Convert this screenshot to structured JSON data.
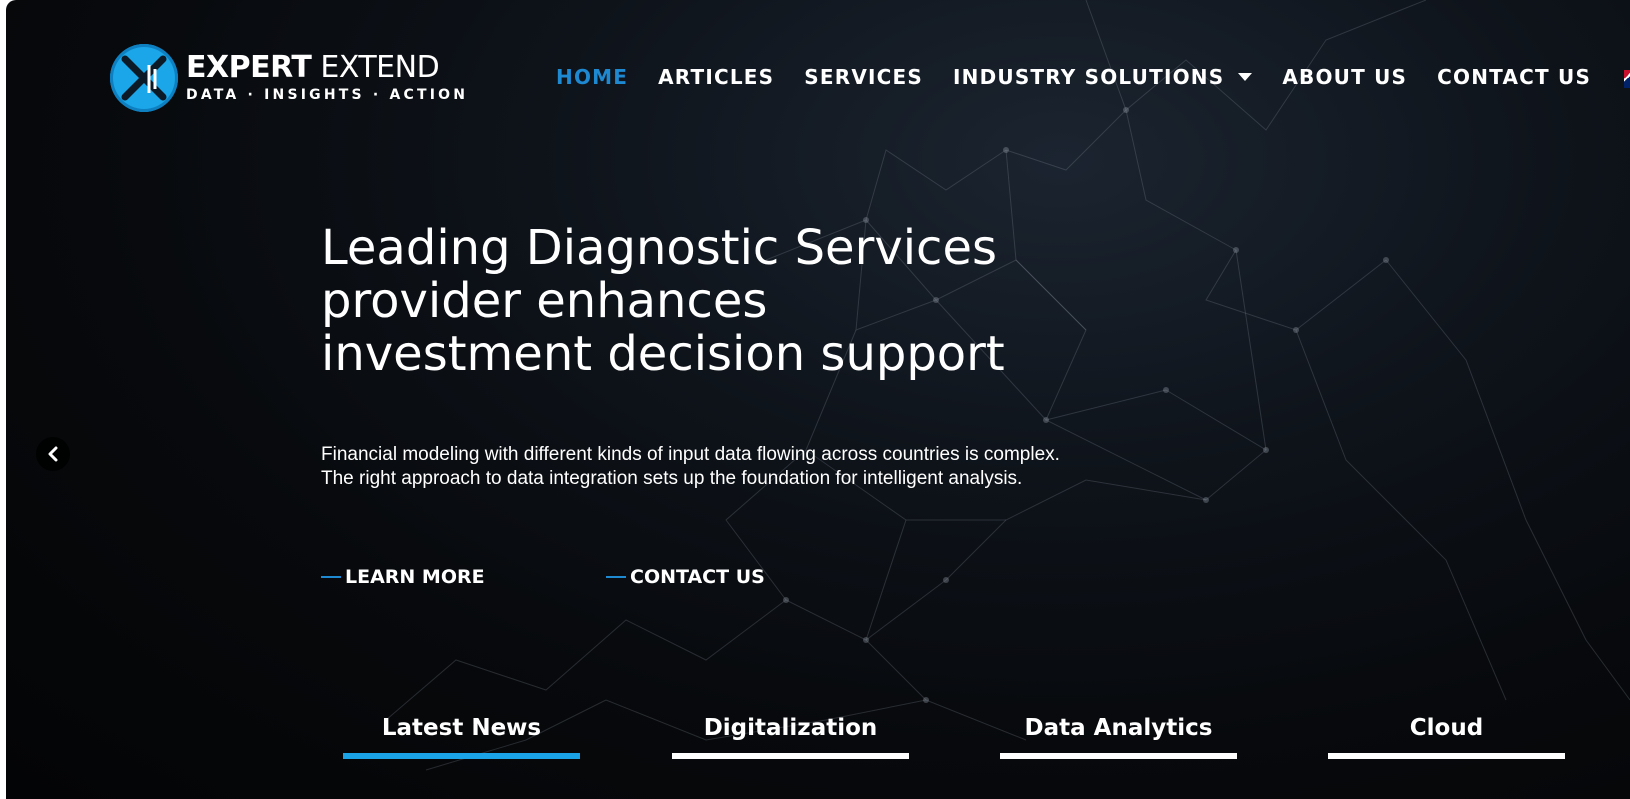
{
  "brand": {
    "name_bold": "EXPERT",
    "name_light": "EXTEND",
    "tagline": "DATA · INSIGHTS · ACTION",
    "accent_color": "#1aa6e8"
  },
  "nav": {
    "items": [
      {
        "label": "HOME",
        "active": true
      },
      {
        "label": "ARTICLES"
      },
      {
        "label": "SERVICES"
      },
      {
        "label": "INDUSTRY SOLUTIONS",
        "has_dropdown": true
      },
      {
        "label": "ABOUT US"
      },
      {
        "label": "CONTACT US"
      }
    ],
    "active_color": "#1e88d0",
    "language_flag": "uk-flag-icon"
  },
  "hero": {
    "title_lines": [
      "Leading Diagnostic Services",
      "provider enhances",
      "investment decision support"
    ],
    "description": "Financial modeling with different kinds of input data flowing across countries is complex. The right approach to data integration sets up the foundation for intelligent analysis.",
    "cta_learn_more": "LEARN MORE",
    "cta_contact": "CONTACT US",
    "prev_icon": "chevron-left-icon"
  },
  "tabs": [
    {
      "label": "Latest News",
      "active": true
    },
    {
      "label": "Digitalization"
    },
    {
      "label": "Data Analytics"
    },
    {
      "label": "Cloud"
    }
  ]
}
